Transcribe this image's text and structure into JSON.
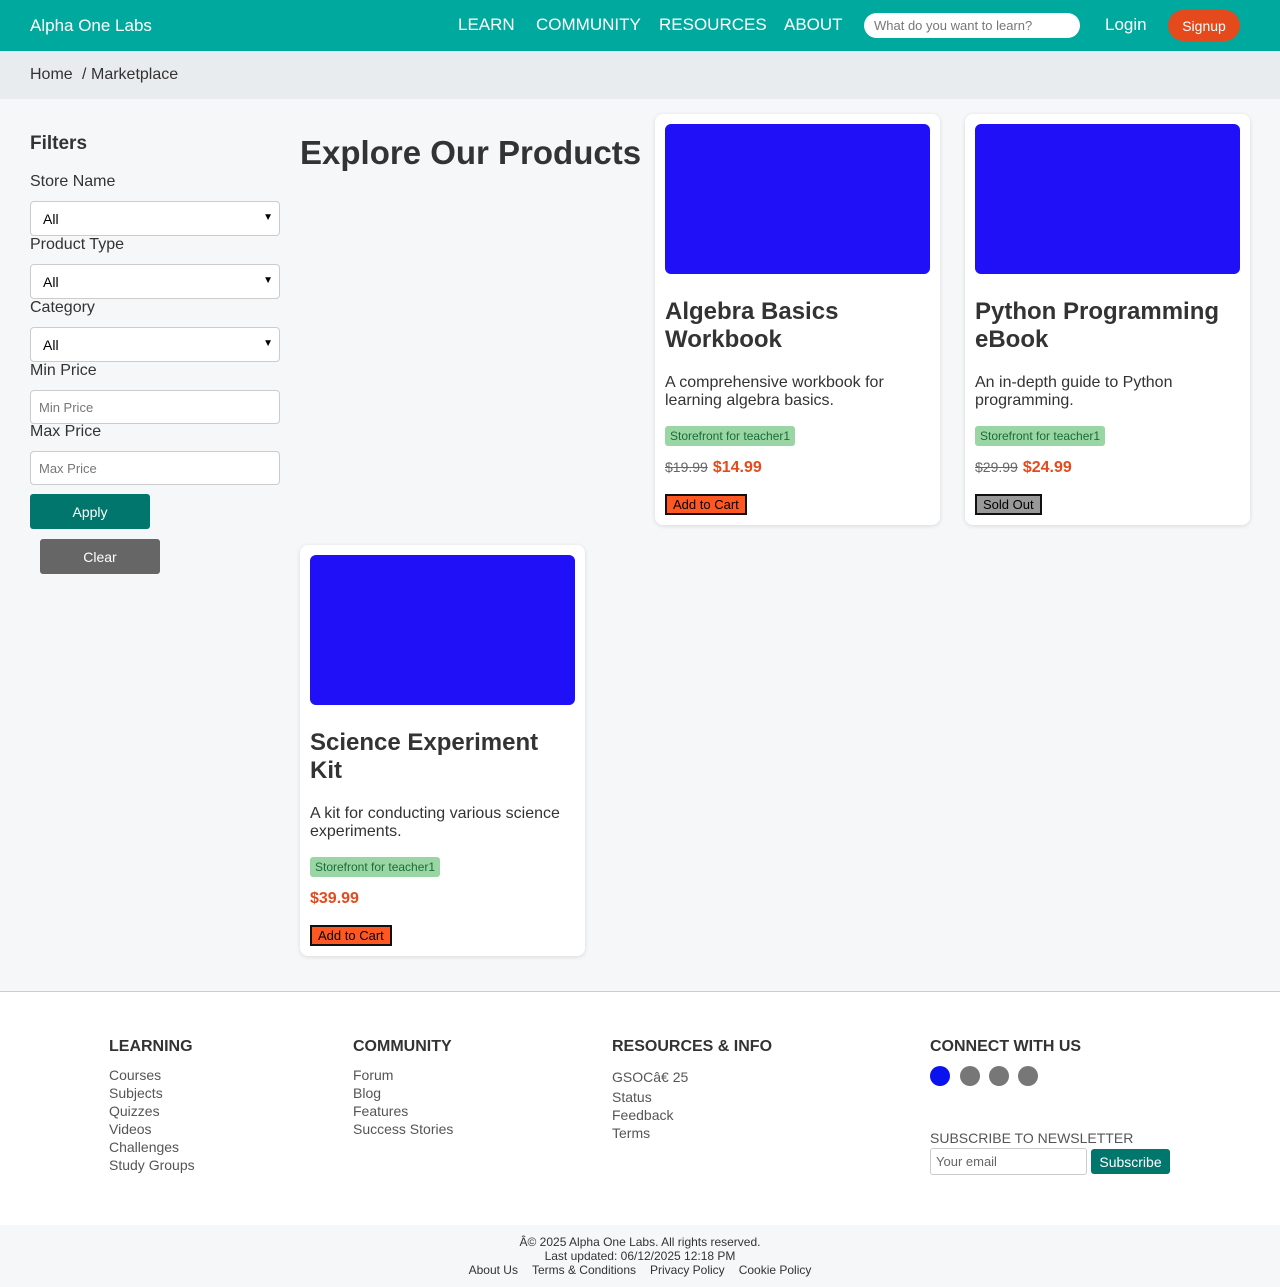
{
  "header": {
    "brand": "Alpha One Labs",
    "nav": [
      "LEARN",
      "COMMUNITY",
      "RESOURCES",
      "ABOUT"
    ],
    "search_placeholder": "What do you want to learn?",
    "login": "Login",
    "signup": "Signup"
  },
  "breadcrumb": {
    "home": "Home",
    "separator": "/",
    "current": "Marketplace"
  },
  "filters": {
    "title": "Filters",
    "store_label": "Store Name",
    "store_value": "All",
    "type_label": "Product Type",
    "type_value": "All",
    "category_label": "Category",
    "category_value": "All",
    "min_label": "Min Price",
    "min_placeholder": "Min Price",
    "max_label": "Max Price",
    "max_placeholder": "Max Price",
    "apply": "Apply",
    "clear": "Clear"
  },
  "main": {
    "heading": "Explore Our Products"
  },
  "products": [
    {
      "title": "Algebra Basics Workbook",
      "description": "A comprehensive workbook for learning algebra basics.",
      "store": "Storefront for teacher1",
      "old_price": "$19.99",
      "price": "$14.99",
      "action": "Add to Cart"
    },
    {
      "title": "Python Programming eBook",
      "description": "An in-depth guide to Python programming.",
      "store": "Storefront for teacher1",
      "old_price": "$29.99",
      "price": "$24.99",
      "action": "Sold Out"
    },
    {
      "title": "Science Experiment Kit",
      "description": "A kit for conducting various science experiments.",
      "store": "Storefront for teacher1",
      "price": "$39.99",
      "action": "Add to Cart"
    }
  ],
  "footer": {
    "learning": {
      "title": "LEARNING",
      "links": [
        "Courses",
        "Subjects",
        "Quizzes",
        "Videos",
        "Challenges",
        "Study Groups"
      ]
    },
    "community": {
      "title": "COMMUNITY",
      "links": [
        "Forum",
        "Blog",
        "Features",
        "Success Stories"
      ]
    },
    "resources": {
      "title": "RESOURCES & INFO",
      "gsoc": "GSOCâ€    25",
      "links": [
        "Status",
        "Feedback",
        "Terms"
      ]
    },
    "connect": {
      "title": "CONNECT WITH US",
      "social_icons": [
        "social-icon-1",
        "social-icon-2",
        "social-icon-3",
        "social-icon-4"
      ],
      "social_colors": [
        "#0a12f0",
        "#777777",
        "#777777",
        "#777777"
      ],
      "newsletter_label": "SUBSCRIBE TO NEWSLETTER",
      "email_placeholder": "Your email",
      "subscribe": "Subscribe"
    },
    "copyright": "Â© 2025 Alpha One Labs. All rights reserved.",
    "updated": "Last updated: 06/12/2025 12:18 PM",
    "legal": [
      "About Us",
      "Terms & Conditions",
      "Privacy Policy",
      "Cookie Policy"
    ]
  },
  "colors": {
    "brand": "#00a99d",
    "accent": "#e54a1d",
    "button_primary": "#00766c",
    "product_image_placeholder": "#1f10f7"
  }
}
